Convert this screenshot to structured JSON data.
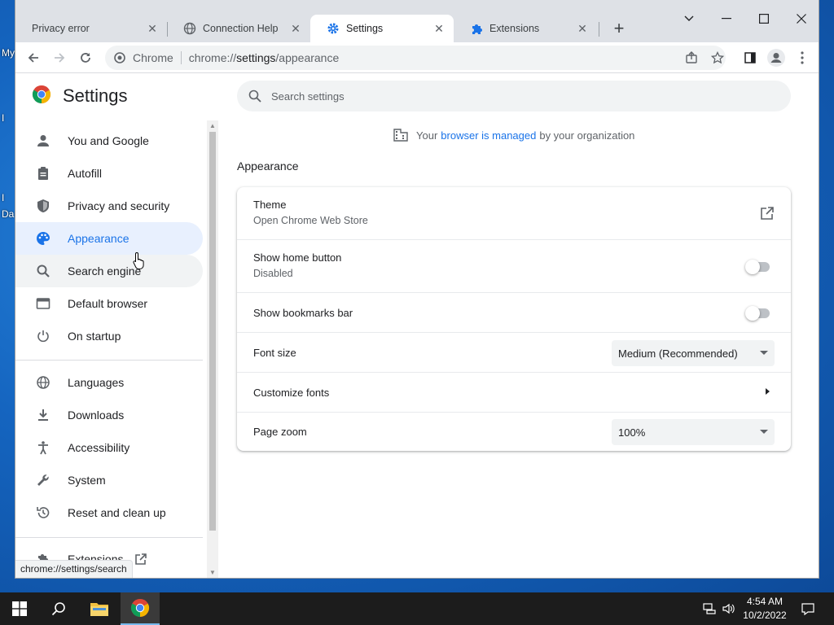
{
  "desktop": {
    "labels": [
      "My",
      "I",
      "I",
      "Da"
    ]
  },
  "tabs": [
    {
      "title": "Privacy error",
      "icon": "none",
      "active": false
    },
    {
      "title": "Connection Help",
      "icon": "globe-icon",
      "active": false
    },
    {
      "title": "Settings",
      "icon": "gear-icon",
      "active": true
    },
    {
      "title": "Extensions",
      "icon": "puzzle-icon",
      "active": false
    }
  ],
  "omnibox": {
    "site_name": "Chrome",
    "url_scheme": "chrome://",
    "url_host": "settings",
    "url_path": "/appearance"
  },
  "settings": {
    "title": "Settings",
    "search_placeholder": "Search settings"
  },
  "sidebar": {
    "items": [
      {
        "label": "You and Google",
        "icon": "person-icon"
      },
      {
        "label": "Autofill",
        "icon": "clipboard-icon"
      },
      {
        "label": "Privacy and security",
        "icon": "shield-icon"
      },
      {
        "label": "Appearance",
        "icon": "palette-icon",
        "selected": true
      },
      {
        "label": "Search engine",
        "icon": "search-icon",
        "hover": true
      },
      {
        "label": "Default browser",
        "icon": "browser-icon"
      },
      {
        "label": "On startup",
        "icon": "power-icon"
      },
      {
        "label": "Languages",
        "icon": "globe-icon"
      },
      {
        "label": "Downloads",
        "icon": "download-icon"
      },
      {
        "label": "Accessibility",
        "icon": "accessibility-icon"
      },
      {
        "label": "System",
        "icon": "wrench-icon"
      },
      {
        "label": "Reset and clean up",
        "icon": "history-icon"
      },
      {
        "label": "Extensions",
        "icon": "puzzle-icon"
      }
    ]
  },
  "managed": {
    "prefix": "Your",
    "link": "browser is managed",
    "suffix": "by your organization"
  },
  "appearance": {
    "section_title": "Appearance",
    "theme_label": "Theme",
    "theme_sub": "Open Chrome Web Store",
    "home_label": "Show home button",
    "home_sub": "Disabled",
    "home_enabled": false,
    "bookmarks_label": "Show bookmarks bar",
    "bookmarks_enabled": false,
    "font_size_label": "Font size",
    "font_size_value": "Medium (Recommended)",
    "customize_fonts_label": "Customize fonts",
    "page_zoom_label": "Page zoom",
    "page_zoom_value": "100%"
  },
  "status_bar": {
    "url": "chrome://settings/search"
  },
  "taskbar": {
    "time": "4:54 AM",
    "date": "10/2/2022"
  },
  "colors": {
    "accent": "#1a73e8",
    "selected_bg": "#e8f0fe",
    "desktop": "#1565c0",
    "taskbar": "#1c1c1c"
  }
}
